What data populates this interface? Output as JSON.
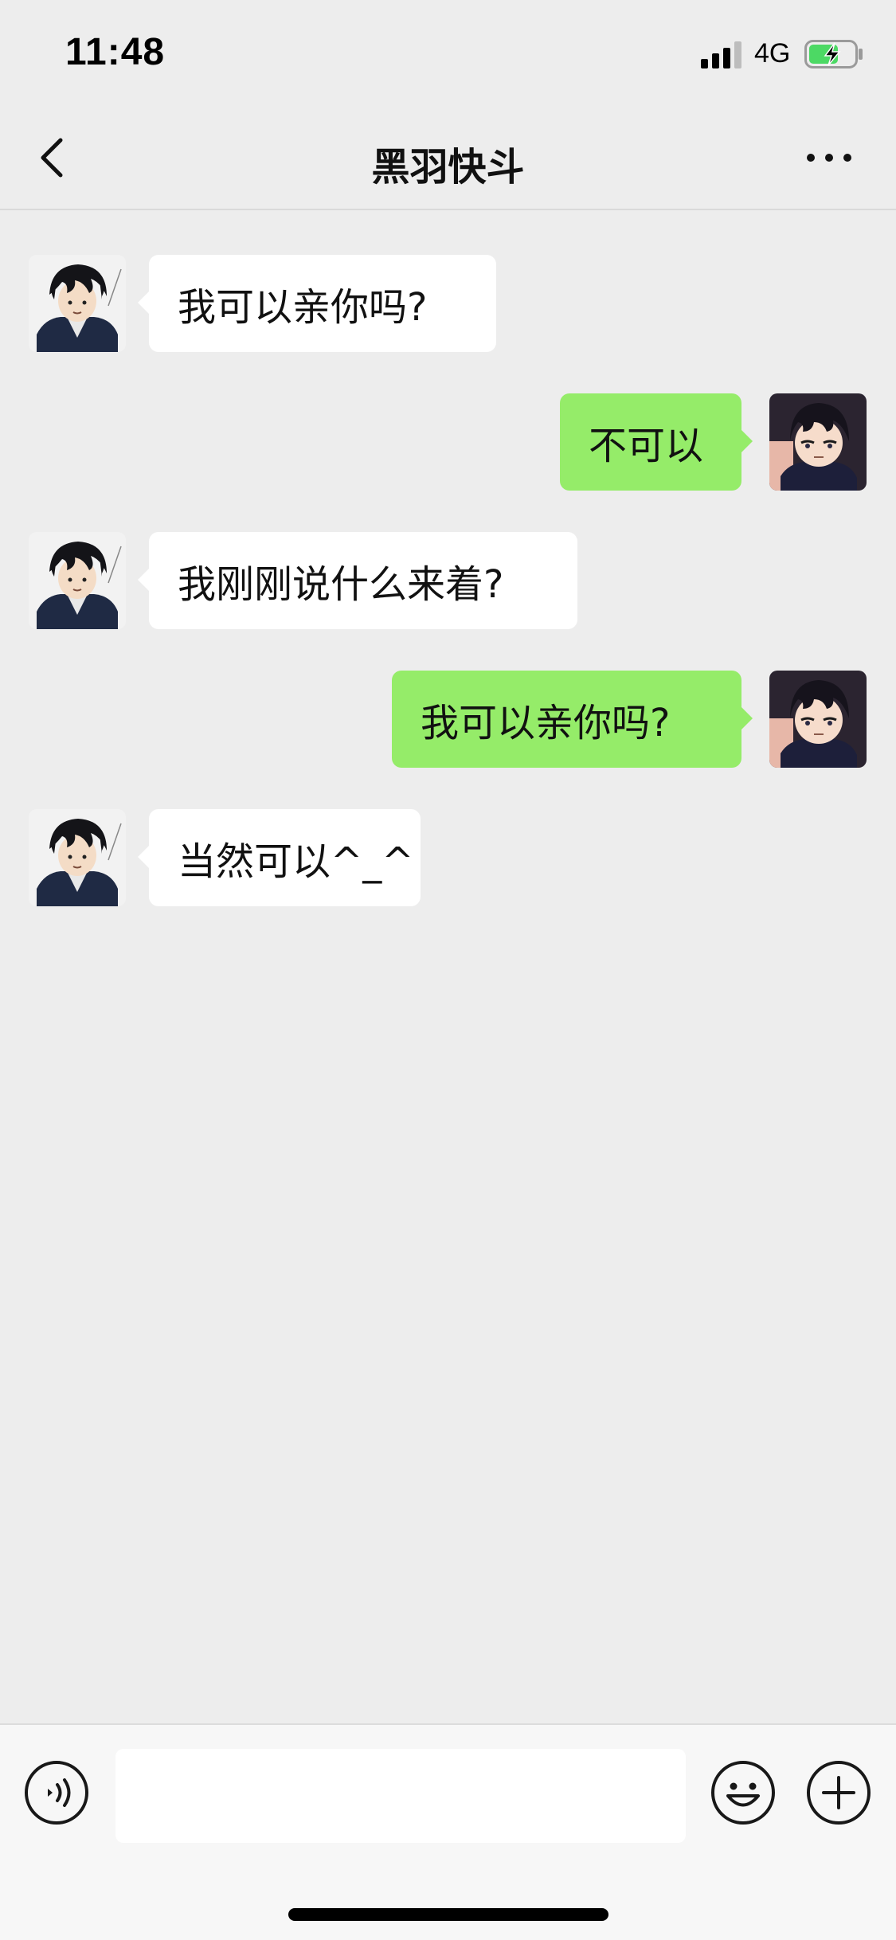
{
  "status_bar": {
    "time": "11:48",
    "network": "4G",
    "icons": [
      "signal-icon",
      "battery-charging-icon"
    ]
  },
  "nav": {
    "title": "黑羽快斗",
    "icons": [
      "back-chevron-icon",
      "more-dots-icon"
    ]
  },
  "messages": [
    {
      "sender": "contact",
      "text": "我可以亲你吗?"
    },
    {
      "sender": "me",
      "text": "不可以"
    },
    {
      "sender": "contact",
      "text": "我刚刚说什么来着?"
    },
    {
      "sender": "me",
      "text": "我可以亲你吗?"
    },
    {
      "sender": "contact",
      "text": "当然可以^_^"
    }
  ],
  "input_bar": {
    "value": "",
    "icons": [
      "voice-icon",
      "emoji-icon",
      "add-icon"
    ]
  },
  "colors": {
    "background": "#ededed",
    "incoming_bubble": "#ffffff",
    "outgoing_bubble": "#95ec69",
    "battery_charge": "#4cd964"
  }
}
